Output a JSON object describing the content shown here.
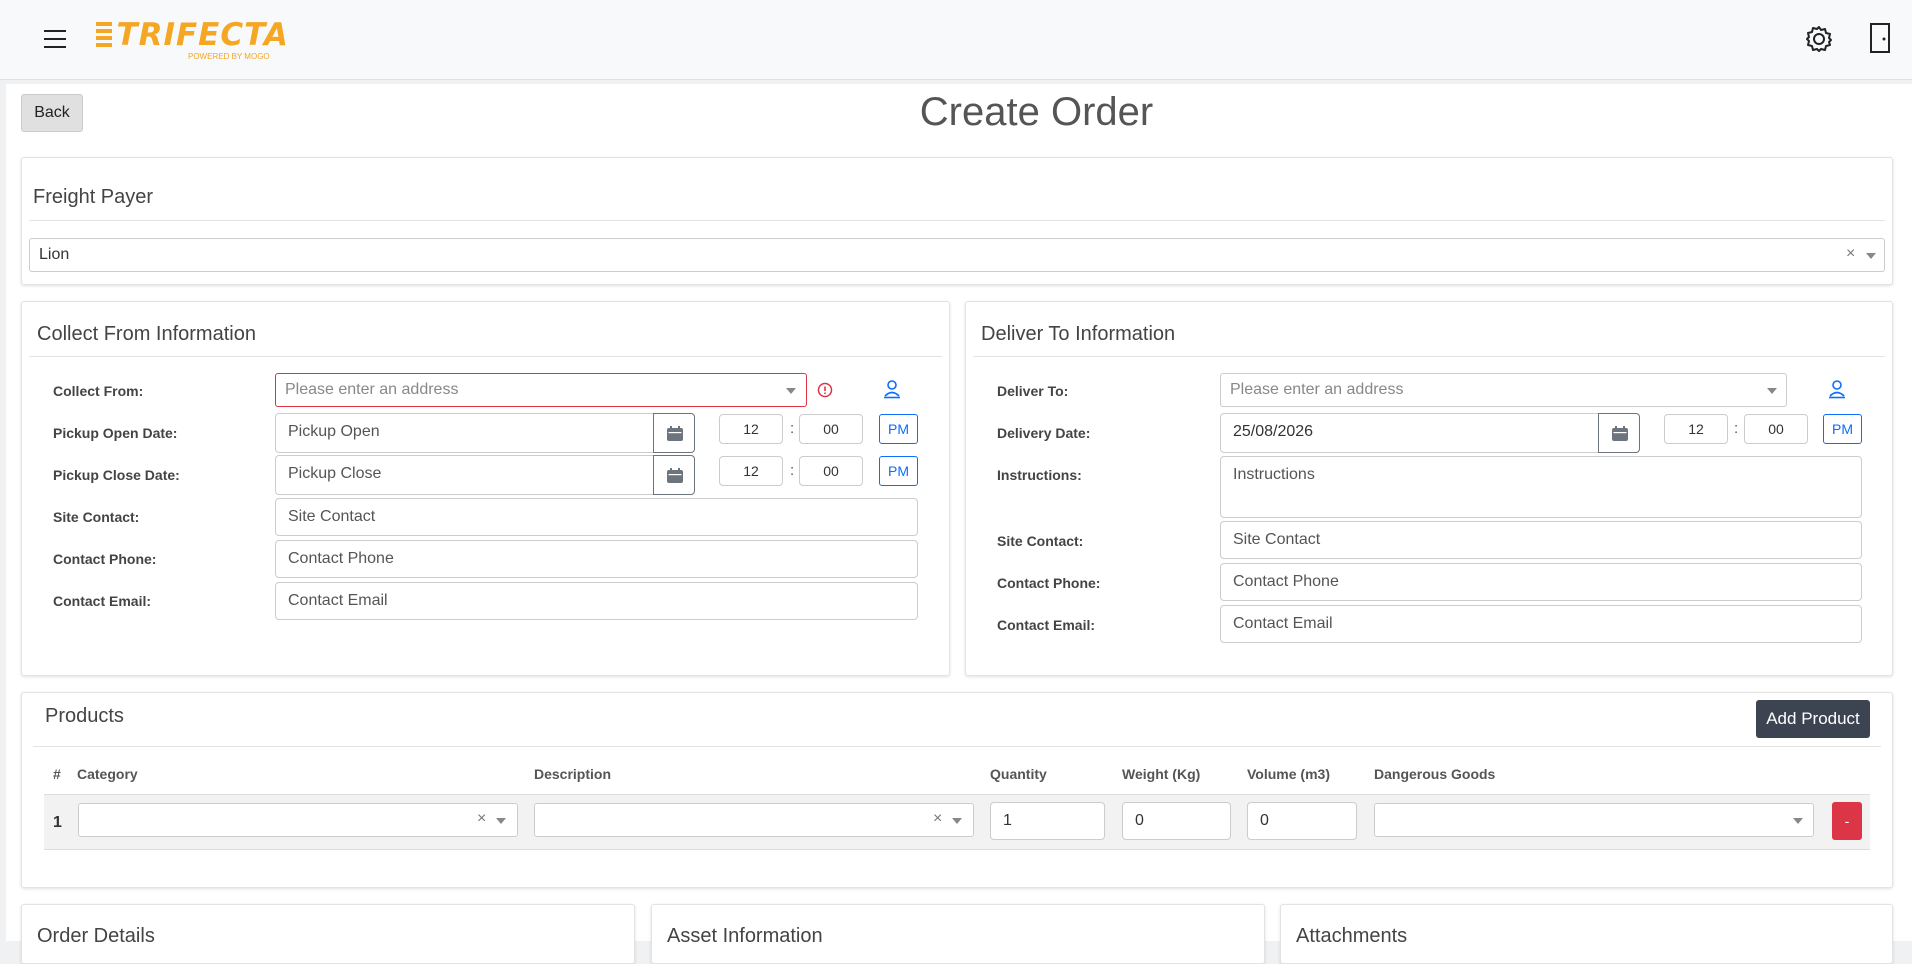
{
  "header": {
    "logo_text": "TRIFECTA",
    "logo_sub": "POWERED BY MOGO",
    "accent": "#f5a623"
  },
  "page": {
    "back_label": "Back",
    "title": "Create Order"
  },
  "freight_payer": {
    "title": "Freight Payer",
    "value": "Lion",
    "clear": "×"
  },
  "collect": {
    "title": "Collect From Information",
    "collect_from_label": "Collect From:",
    "collect_from_placeholder": "Please enter an address",
    "pickup_open_label": "Pickup Open Date:",
    "pickup_open_placeholder": "Pickup Open",
    "pickup_open_hour": "12",
    "pickup_open_minute": "00",
    "pickup_open_ampm": "PM",
    "pickup_close_label": "Pickup Close Date:",
    "pickup_close_placeholder": "Pickup Close",
    "pickup_close_hour": "12",
    "pickup_close_minute": "00",
    "pickup_close_ampm": "PM",
    "site_contact_label": "Site Contact:",
    "site_contact_placeholder": "Site Contact",
    "contact_phone_label": "Contact Phone:",
    "contact_phone_placeholder": "Contact Phone",
    "contact_email_label": "Contact Email:",
    "contact_email_placeholder": "Contact Email",
    "colon": ":"
  },
  "deliver": {
    "title": "Deliver To Information",
    "deliver_to_label": "Deliver To:",
    "deliver_to_placeholder": "Please enter an address",
    "delivery_date_label": "Delivery Date:",
    "delivery_date_value": "25/08/2026",
    "delivery_hour": "12",
    "delivery_minute": "00",
    "delivery_ampm": "PM",
    "instructions_label": "Instructions:",
    "instructions_placeholder": "Instructions",
    "site_contact_label": "Site Contact:",
    "site_contact_placeholder": "Site Contact",
    "contact_phone_label": "Contact Phone:",
    "contact_phone_placeholder": "Contact Phone",
    "contact_email_label": "Contact Email:",
    "contact_email_placeholder": "Contact Email",
    "colon": ":"
  },
  "products": {
    "title": "Products",
    "add_label": "Add Product",
    "columns": [
      "#",
      "Category",
      "Description",
      "Quantity",
      "Weight (Kg)",
      "Volume (m3)",
      "Dangerous Goods"
    ],
    "rows": [
      {
        "num": "1",
        "category": "",
        "description": "",
        "quantity": "1",
        "weight": "0",
        "volume": "0",
        "dangerous_goods": "",
        "remove_label": "-"
      }
    ],
    "clear": "×"
  },
  "bottom_cards": {
    "order_details": "Order Details",
    "asset_information": "Asset Information",
    "attachments": "Attachments"
  },
  "colors": {
    "danger": "#dc3545",
    "primary": "#0d6efd",
    "dark_button": "#3d4451"
  }
}
